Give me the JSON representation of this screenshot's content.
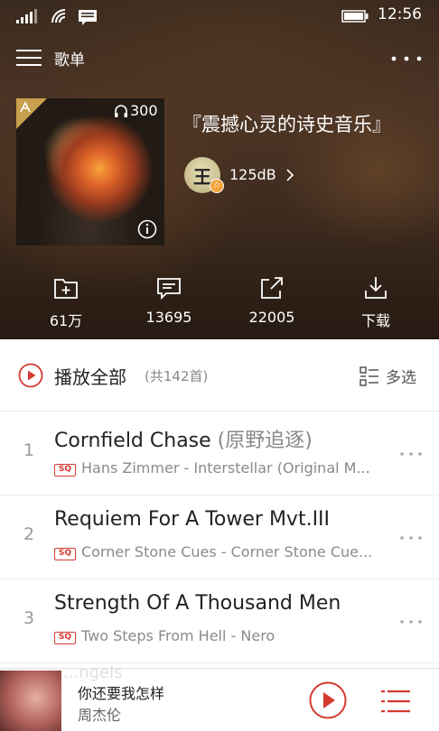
{
  "status_bar": {
    "time": "12:56"
  },
  "header": {
    "title": "歌单"
  },
  "playlist": {
    "name": "『震撼心灵的诗史音乐』",
    "listen_count": "300",
    "creator": "125dB",
    "avatar_char": "王",
    "avatar_badge": "☆"
  },
  "actions": [
    {
      "icon": "add-folder-icon",
      "label": "61万"
    },
    {
      "icon": "comment-icon",
      "label": "13695"
    },
    {
      "icon": "share-icon",
      "label": "22005"
    },
    {
      "icon": "download-icon",
      "label": "下载"
    }
  ],
  "play_all": {
    "label": "播放全部",
    "count": "(共142首)",
    "multi_select": "多选"
  },
  "songs": [
    {
      "num": "1",
      "title": "Cornfield Chase",
      "alias": " (原野追逐)",
      "badge": "SQ",
      "sub": "Hans Zimmer - Interstellar (Original M..."
    },
    {
      "num": "2",
      "title": "Requiem For A Tower Mvt.III",
      "alias": "",
      "badge": "SQ",
      "sub": "Corner Stone Cues - Corner Stone Cue..."
    },
    {
      "num": "3",
      "title": "Strength Of A Thousand Men",
      "alias": "",
      "badge": "SQ",
      "sub": "Two Steps From Hell - Nero"
    }
  ],
  "next_peek": "...ngels",
  "player": {
    "title": "你还要我怎样",
    "artist": "周杰伦"
  },
  "colors": {
    "accent": "#d33a31",
    "header_bg": "#3f2c1f",
    "badge": "#f1a53b"
  }
}
